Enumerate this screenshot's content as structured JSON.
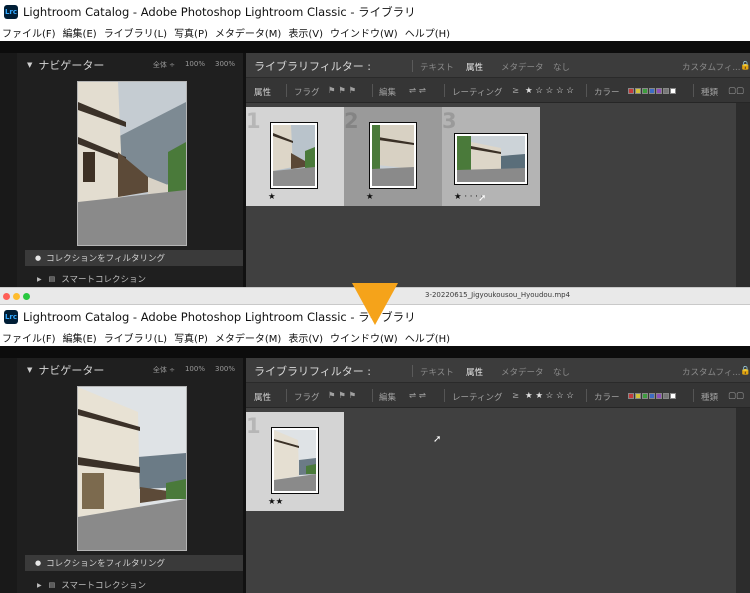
{
  "window": {
    "title": "Lightroom Catalog - Adobe Photoshop Lightroom Classic - ライブラリ",
    "app_icon": "Lrc"
  },
  "menu": [
    "ファイル(F)",
    "編集(E)",
    "ライブラリ(L)",
    "写真(P)",
    "メタデータ(M)",
    "表示(V)",
    "ウインドウ(W)",
    "ヘルプ(H)"
  ],
  "navigator": {
    "title": "ナビゲーター",
    "zoom_options": [
      "全体 ÷",
      "100%",
      "300%"
    ]
  },
  "filter_bar": {
    "label": "ライブラリフィルター :",
    "tabs": [
      "テキスト",
      "属性",
      "メタデータ",
      "なし"
    ],
    "active_tab": "属性",
    "custom": "カスタムフィ...",
    "lock": "🔒"
  },
  "attribute_bar": {
    "label": "属性",
    "flag": "フラグ",
    "edit": "編集",
    "rating": "レーティング",
    "rating_op": "≥",
    "color": "カラー",
    "kind": "種類",
    "swatch_colors": [
      "#c23b3b",
      "#d1c23a",
      "#3e9c3e",
      "#3e6cc4",
      "#8f4fb8",
      "#777777",
      "#ffffff"
    ]
  },
  "collections": {
    "filter_collection": "コレクションをフィルタリング",
    "smart_collection": "スマートコレクション"
  },
  "top": {
    "rating_filter_stars": 1,
    "rating_filter": "★ ☆ ☆ ☆ ☆",
    "thumbnails": [
      {
        "index": "1",
        "stars": "★"
      },
      {
        "index": "2",
        "stars": "★"
      },
      {
        "index": "3",
        "stars": "★ · · · ·"
      }
    ]
  },
  "divider": {
    "video_file": "3-20220615_Jigyoukousou_Hyoudou.mp4"
  },
  "bottom": {
    "rating_filter_stars": 2,
    "rating_filter": "★ ★ ☆ ☆ ☆",
    "thumbnails": [
      {
        "index": "1",
        "stars": "★★"
      }
    ]
  },
  "colors": {
    "arrow": "#f5a31a",
    "panel_bg": "#2b2b2b",
    "grid_bg": "#404040",
    "lrc_blue": "#31a8ff"
  }
}
